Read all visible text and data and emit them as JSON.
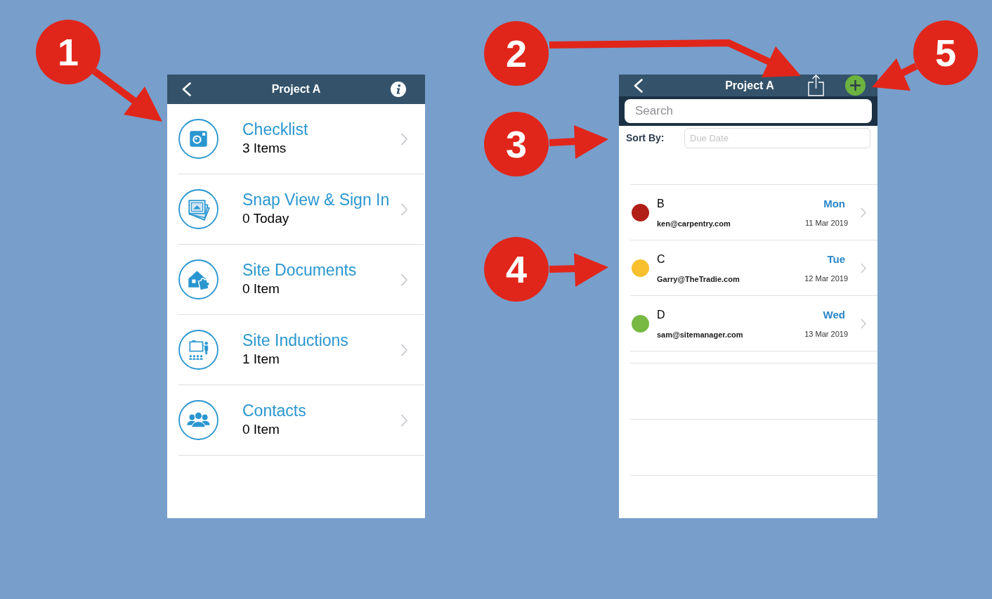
{
  "left_screen": {
    "nav_bar": {
      "title": "Project A"
    },
    "items": [
      {
        "title": "Checklist",
        "subtitle": "3 Items"
      },
      {
        "title": "Snap View & Sign In",
        "subtitle": "0 Today"
      },
      {
        "title": "Site Documents",
        "subtitle": "0 Item"
      },
      {
        "title": "Site Inductions",
        "subtitle": "1 Item"
      },
      {
        "title": "Contacts",
        "subtitle": "0 Item"
      }
    ]
  },
  "right_screen": {
    "nav_bar": {
      "title": "Project A"
    },
    "search": {
      "placeholder": "Search"
    },
    "sort": {
      "label": "Sort By:",
      "placeholder": "Due Date"
    },
    "rows": [
      {
        "name": "B",
        "email": "ken@carpentry.com",
        "day": "Mon",
        "date": "11 Mar 2019",
        "color": "#b01e17"
      },
      {
        "name": "C",
        "email": "Garry@TheTradie.com",
        "day": "Tue",
        "date": "12 Mar 2019",
        "color": "#f8c02e"
      },
      {
        "name": "D",
        "email": "sam@sitemanager.com",
        "day": "Wed",
        "date": "13 Mar 2019",
        "color": "#78b943"
      }
    ]
  },
  "callouts": [
    {
      "number": "1"
    },
    {
      "number": "2"
    },
    {
      "number": "3"
    },
    {
      "number": "4"
    },
    {
      "number": "5"
    }
  ]
}
